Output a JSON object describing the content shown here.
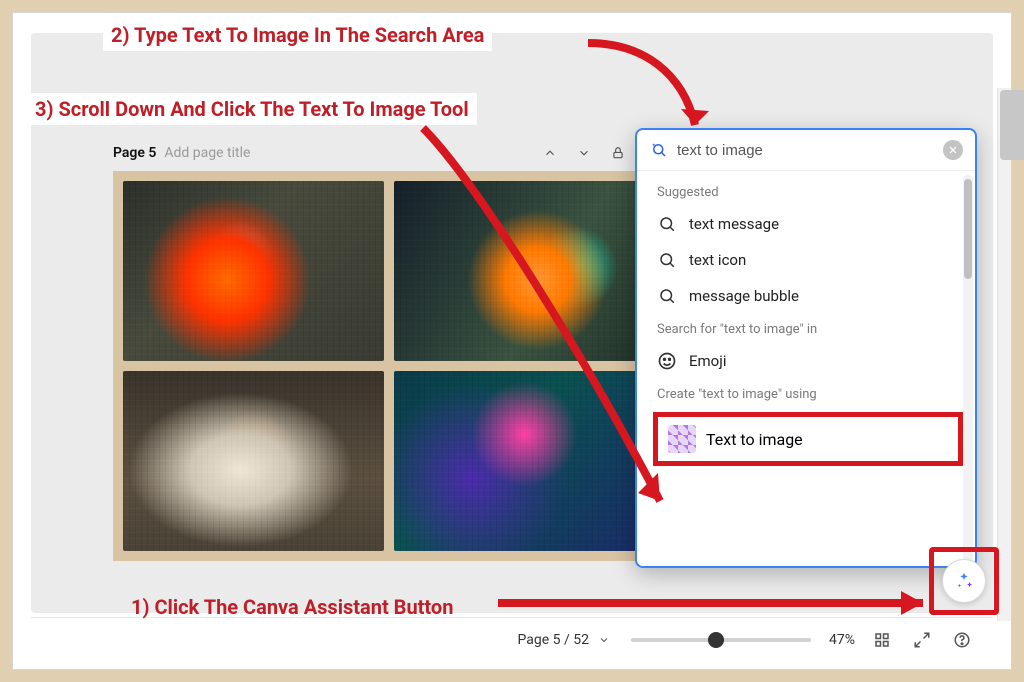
{
  "annotations": {
    "step1": "1) Click The Canva Assistant Button",
    "step2": "2) Type Text To Image In The Search Area",
    "step3": "3) Scroll Down And Click The Text To Image Tool"
  },
  "page_header": {
    "label": "Page 5",
    "separator": " - ",
    "title_placeholder": "Add page title"
  },
  "status": {
    "page_indicator": "Page 5 / 52",
    "zoom": "47%"
  },
  "panel": {
    "search_value": "text to image",
    "suggested_label": "Suggested",
    "suggestions": [
      "text message",
      "text icon",
      "message bubble"
    ],
    "search_in_label": "Search for \"text to image\" in",
    "search_in_option": "Emoji",
    "create_label": "Create \"text to image\" using",
    "create_option": "Text to image"
  }
}
